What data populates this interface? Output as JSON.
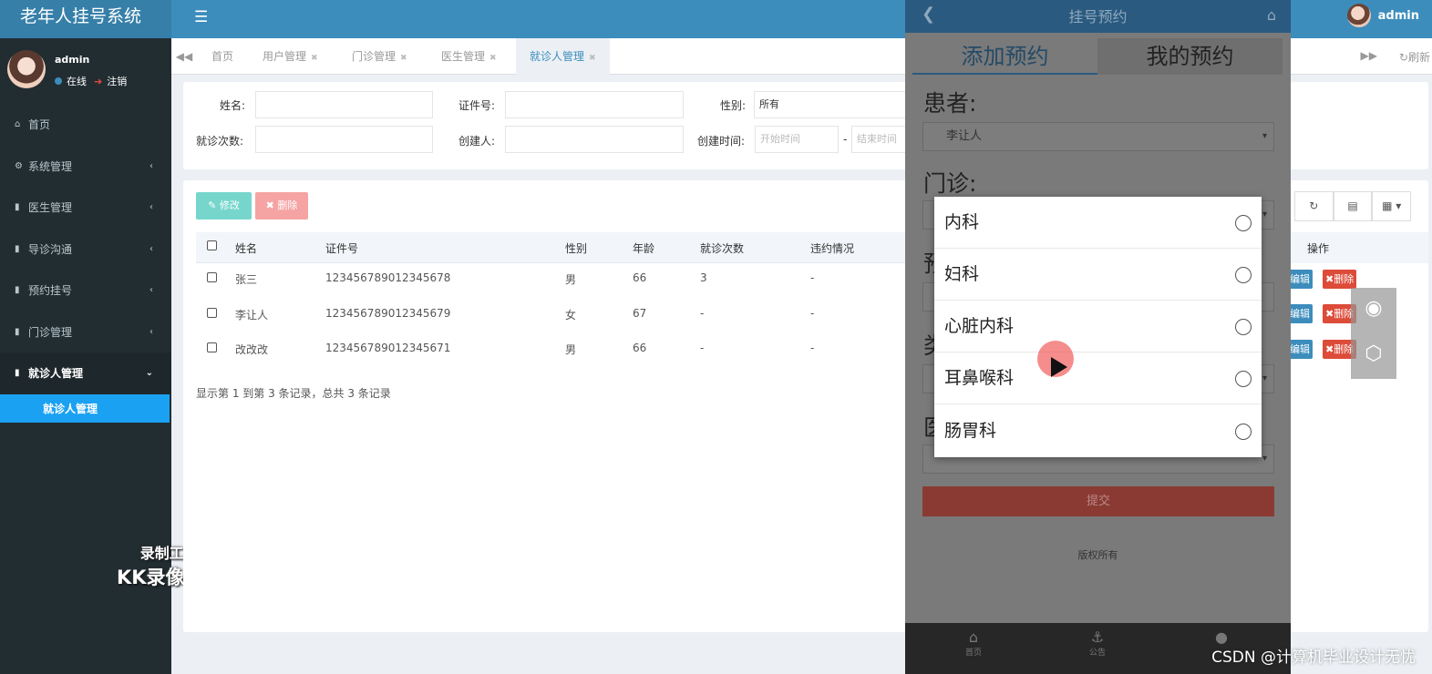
{
  "app": {
    "title": "老年人挂号系统",
    "username": "admin"
  },
  "sidebar": {
    "user": {
      "name": "admin",
      "online": "在线",
      "logout": "注销"
    },
    "items": [
      {
        "label": "首页",
        "icon": "home-icon"
      },
      {
        "label": "系统管理",
        "icon": "gear-icon"
      },
      {
        "label": "医生管理",
        "icon": "book-icon"
      },
      {
        "label": "导诊沟通",
        "icon": "book-icon"
      },
      {
        "label": "预约挂号",
        "icon": "book-icon"
      },
      {
        "label": "门诊管理",
        "icon": "book-icon"
      },
      {
        "label": "就诊人管理",
        "icon": "book-icon"
      }
    ],
    "subitem": "就诊人管理",
    "watermark": {
      "line1": "录制工具",
      "line2": "KK录像机"
    }
  },
  "tabs": [
    "首页",
    "用户管理",
    "门诊管理",
    "医生管理",
    "就诊人管理"
  ],
  "tab_refresh": "刷新",
  "search": {
    "name_label": "姓名:",
    "id_label": "证件号:",
    "gender_label": "性别:",
    "gender_value": "所有",
    "visits_label": "就诊次数:",
    "creator_label": "创建人:",
    "time_label": "创建时间:",
    "start_placeholder": "开始时间",
    "end_placeholder": "结束时间",
    "dash": "-"
  },
  "toolbar": {
    "edit": "修改",
    "delete": "删除"
  },
  "table": {
    "headers": [
      "姓名",
      "证件号",
      "性别",
      "年龄",
      "就诊次数",
      "违约情况",
      "操作"
    ],
    "rows": [
      {
        "name": "张三",
        "id": "123456789012345678",
        "gender": "男",
        "age": "66",
        "visits": "3",
        "breach": "-"
      },
      {
        "name": "李让人",
        "id": "123456789012345679",
        "gender": "女",
        "age": "67",
        "visits": "-",
        "breach": "-"
      },
      {
        "name": "改改改",
        "id": "123456789012345671",
        "gender": "男",
        "age": "66",
        "visits": "-",
        "breach": "-"
      }
    ],
    "row_edit": "编辑",
    "row_delete": "删除",
    "pager": "显示第 1 到第 3 条记录，总共 3 条记录"
  },
  "phone": {
    "title": "挂号预约",
    "tab_add": "添加预约",
    "tab_mine": "我的预约",
    "patient_label": "患者:",
    "patient_value": "李让人",
    "clinic_label": "门诊:",
    "hidden_label_1": "预",
    "hidden_label_2": "类",
    "hidden_label_3": "医",
    "submit": "提交",
    "copyright": "版权所有",
    "bottom_nav": [
      {
        "label": "首页",
        "icon": "home-icon"
      },
      {
        "label": "公告",
        "icon": "anchor-icon"
      },
      {
        "label": "",
        "icon": "user-icon"
      }
    ],
    "options": [
      "内科",
      "妇科",
      "心脏内科",
      "耳鼻喉科",
      "肠胃科"
    ]
  },
  "footer_watermark": "CSDN @计算机毕业设计无忧"
}
